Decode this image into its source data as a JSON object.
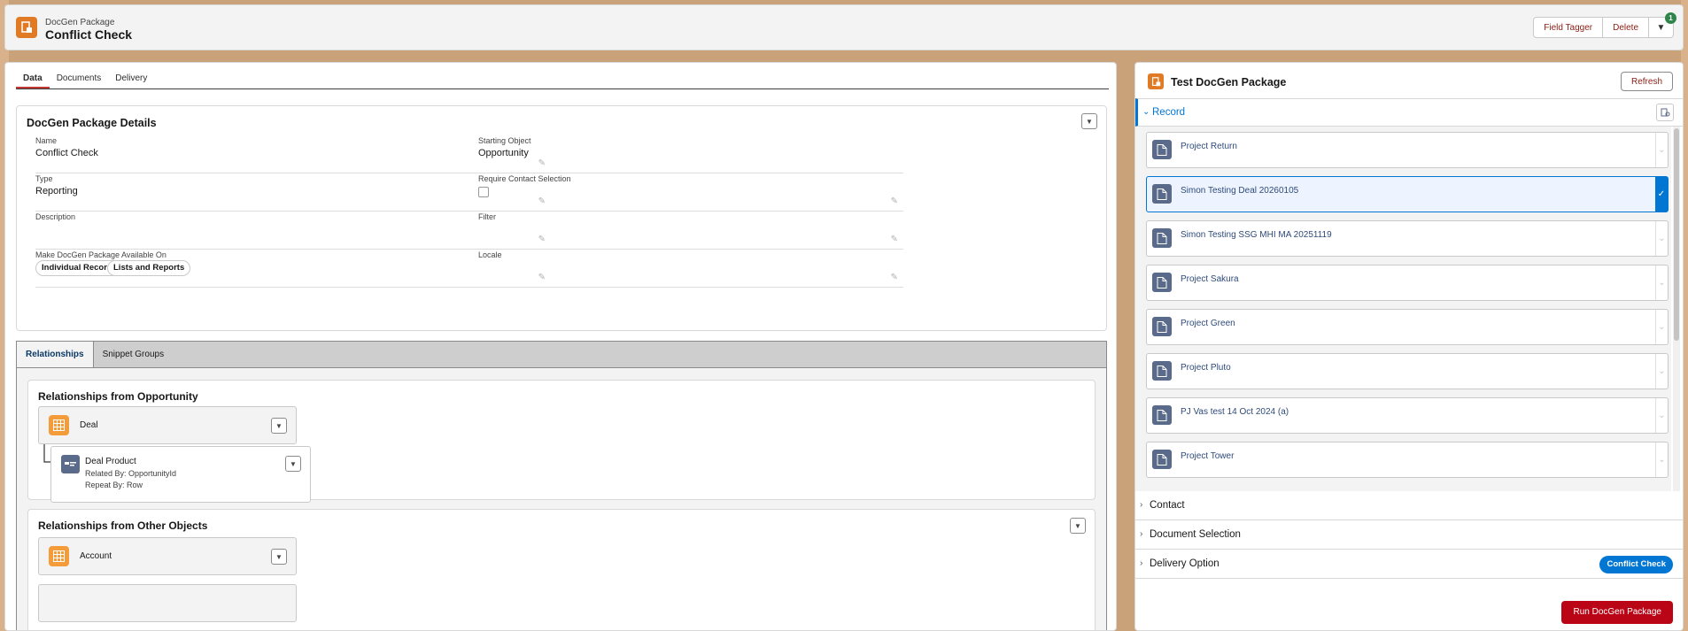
{
  "header": {
    "kicker": "DocGen Package",
    "title": "Conflict Check",
    "actions": {
      "field_tagger": "Field Tagger",
      "delete": "Delete",
      "notification_count": "1"
    }
  },
  "tabs": [
    "Data",
    "Documents",
    "Delivery"
  ],
  "details": {
    "title": "DocGen Package Details",
    "fields": {
      "name": {
        "label": "Name",
        "value": "Conflict Check"
      },
      "starting_object": {
        "label": "Starting Object",
        "value": "Opportunity"
      },
      "type": {
        "label": "Type",
        "value": "Reporting"
      },
      "require_contact": {
        "label": "Require Contact Selection",
        "checked": false
      },
      "description": {
        "label": "Description",
        "value": ""
      },
      "filter": {
        "label": "Filter",
        "value": ""
      },
      "available_on": {
        "label": "Make DocGen Package Available On",
        "pills": [
          "Individual Records",
          "Lists and Reports"
        ]
      },
      "locale": {
        "label": "Locale",
        "value": ""
      }
    }
  },
  "relationship_tabs": [
    "Relationships",
    "Snippet Groups"
  ],
  "relationships": {
    "from_opportunity": {
      "title": "Relationships from Opportunity",
      "parent": "Deal",
      "child": {
        "title": "Deal Product",
        "related_by": "Related By: OpportunityId",
        "repeat_by": "Repeat By: Row"
      }
    },
    "from_other": {
      "title": "Relationships from Other Objects",
      "parent": "Account"
    }
  },
  "side": {
    "title": "Test DocGen Package",
    "refresh": "Refresh",
    "record_section": "Record",
    "records": [
      {
        "name": "Project Return",
        "selected": false
      },
      {
        "name": "Simon Testing Deal 20260105",
        "selected": true
      },
      {
        "name": "Simon Testing SSG MHI MA 20251119",
        "selected": false
      },
      {
        "name": "Project Sakura",
        "selected": false
      },
      {
        "name": "Project Green",
        "selected": false
      },
      {
        "name": "Project Pluto",
        "selected": false
      },
      {
        "name": "PJ Vas test 14 Oct 2024 (a)",
        "selected": false
      },
      {
        "name": "Project Tower",
        "selected": false
      }
    ],
    "sections": {
      "contact": "Contact",
      "document_selection": "Document Selection",
      "delivery_option": "Delivery Option",
      "delivery_badge": "Conflict Check"
    },
    "run": "Run DocGen Package"
  },
  "colors": {
    "accent": "#0176d3",
    "brand": "#e07a25",
    "danger": "#ba0517"
  }
}
